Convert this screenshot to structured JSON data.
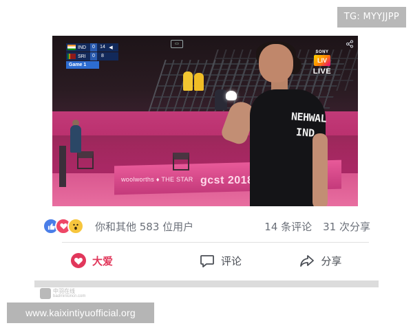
{
  "tag": {
    "text": "TG: MYYJJPP"
  },
  "video": {
    "scoreboard": {
      "rows": [
        {
          "team": "IND",
          "games": "0",
          "points": "14",
          "serve": "◀"
        },
        {
          "team": "SRI",
          "games": "0",
          "points": "8",
          "serve": ""
        }
      ],
      "game_label": "Game 1"
    },
    "broadcaster": {
      "brand": "SONY",
      "mark": "LIV",
      "live_label": "LIVE"
    },
    "shirt": {
      "name": "NEHWAL",
      "country": "IND"
    },
    "boards": {
      "main": "gcst 2018",
      "small": "woolworths ♦ THE STAR"
    }
  },
  "reactions": {
    "icons": [
      "like-icon",
      "love-icon",
      "wow-icon"
    ],
    "summary": "你和其他 583 位用户",
    "comments": "14 条评论",
    "shares": "31 次分享"
  },
  "actions": {
    "love_label": "大爱",
    "comment_label": "评论",
    "share_label": "分享"
  },
  "footer_logo": {
    "main": "中羽在线",
    "sub": "badmintoncn.com"
  },
  "site_banner": {
    "text": "www.kaixintiyuofficial.org"
  },
  "colors": {
    "love": "#e1375b",
    "like": "#4a7ee8",
    "wow": "#f7c63d",
    "text_muted": "#6a6f78"
  }
}
